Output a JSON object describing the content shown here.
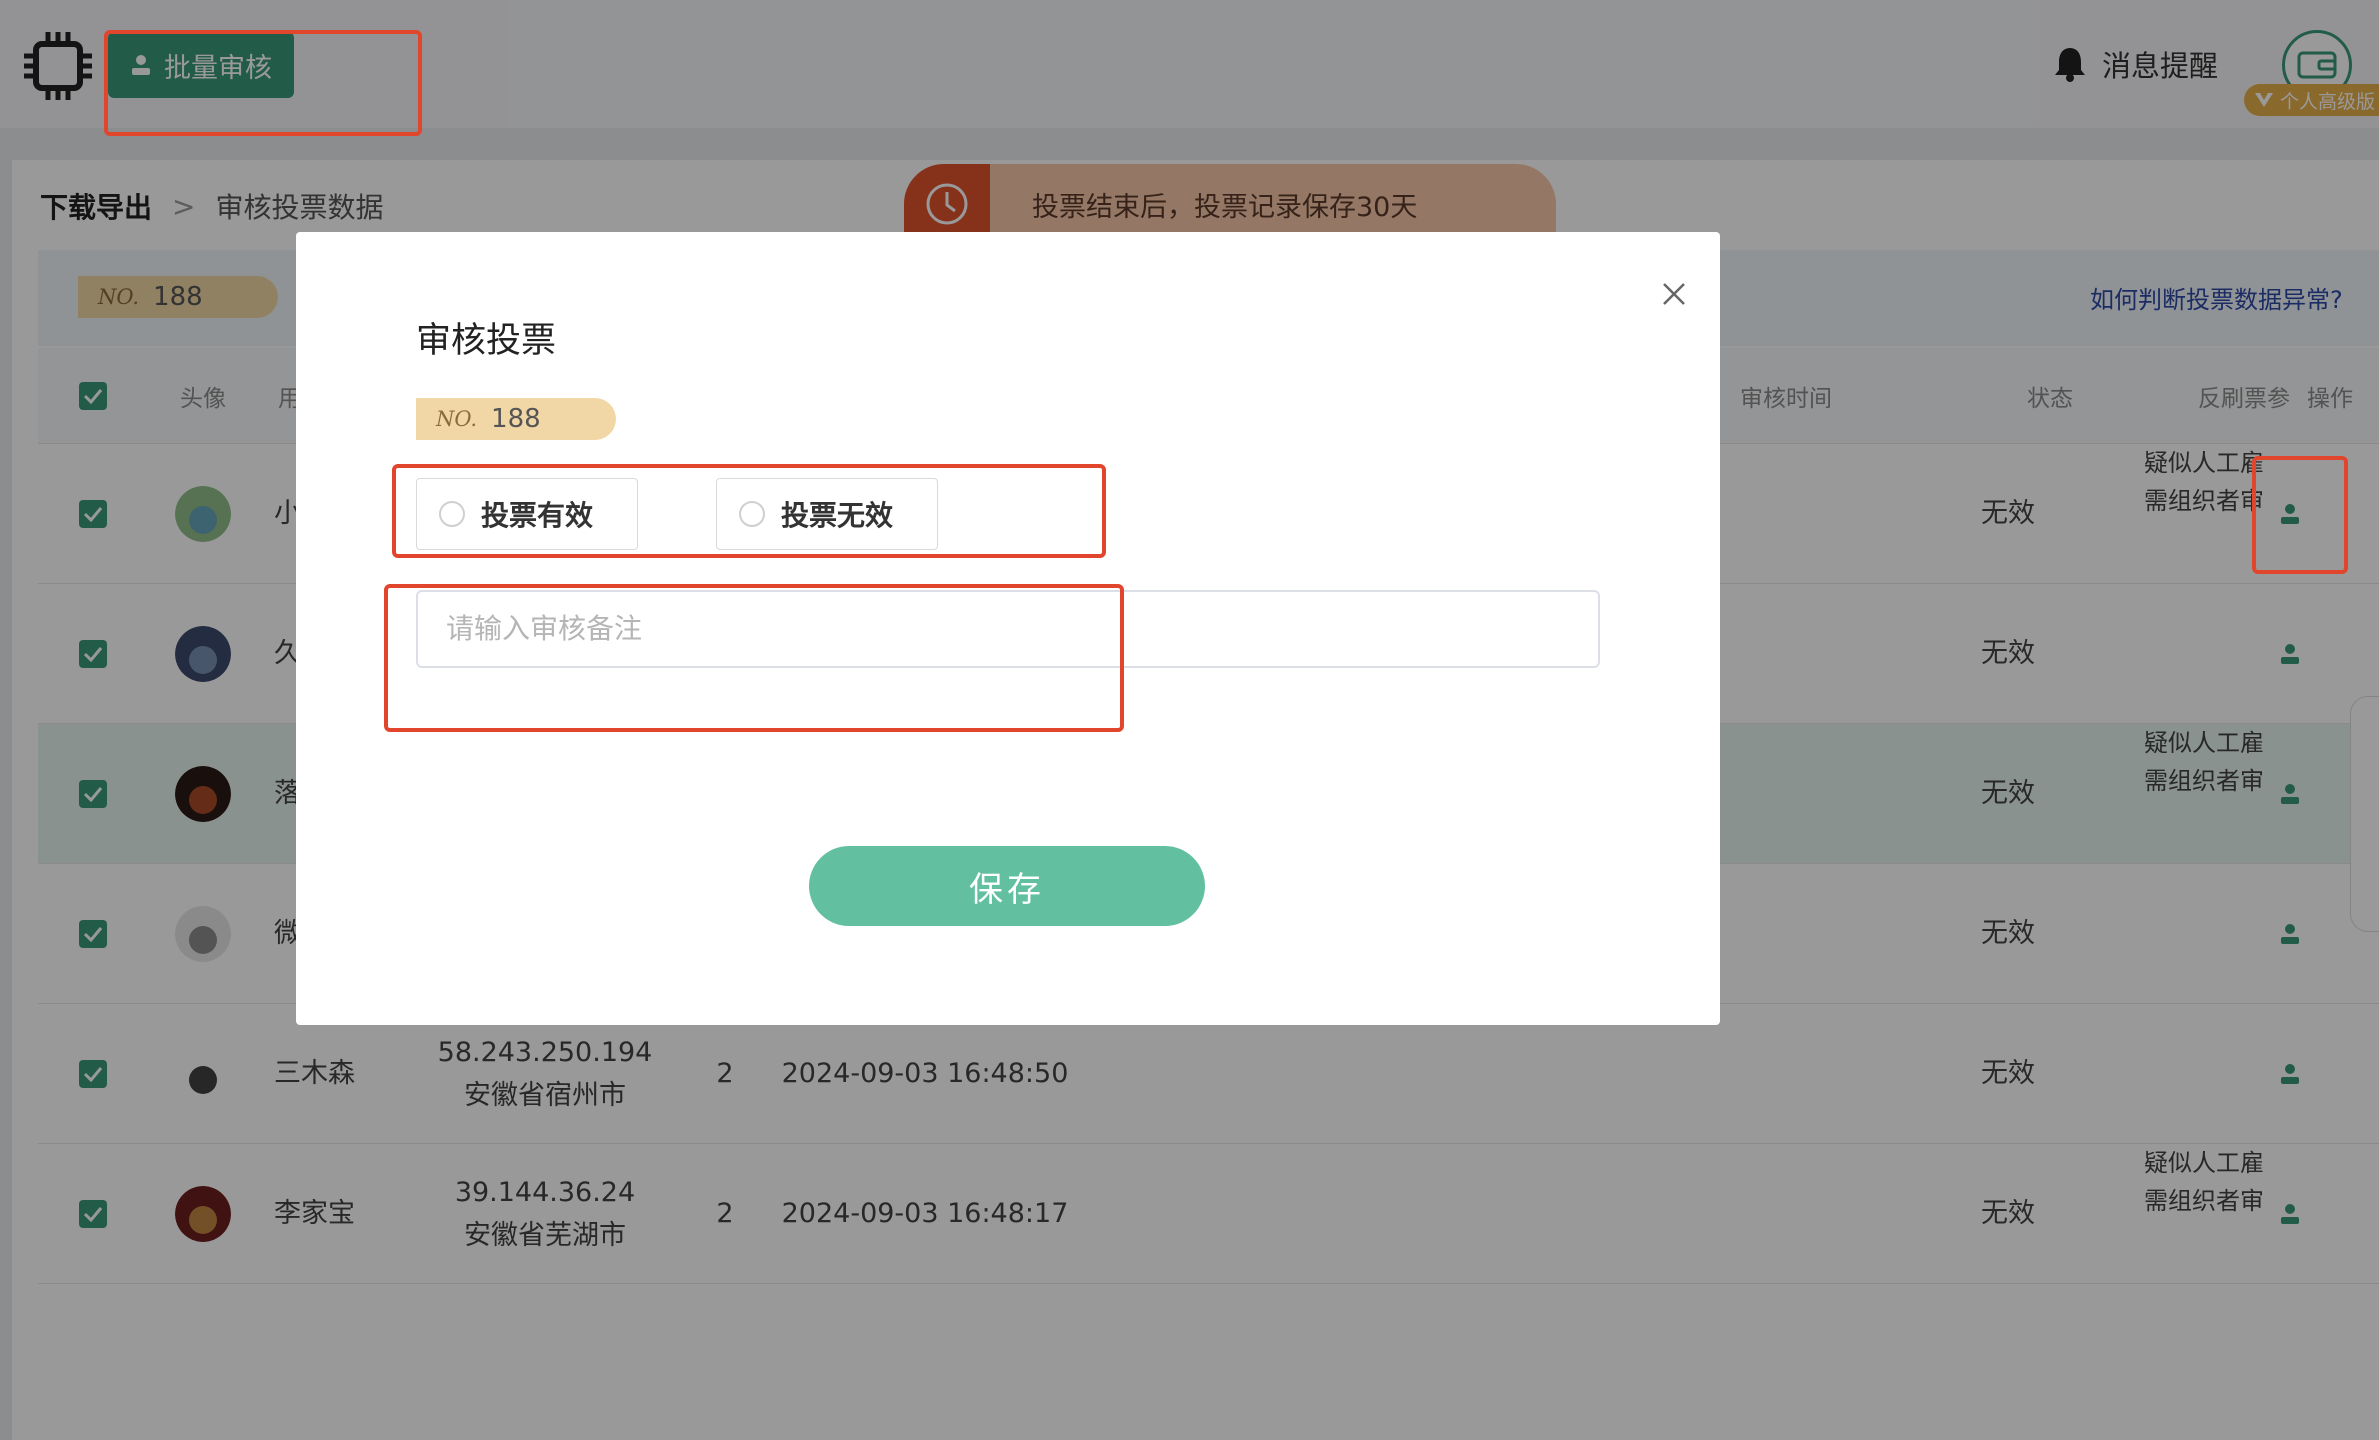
{
  "topbar": {
    "batch_label": "批量审核",
    "notice_label": "消息提醒",
    "vip_label": "个人高级版"
  },
  "breadcrumb": {
    "home": "下载导出",
    "sep": ">",
    "current": "审核投票数据"
  },
  "banner": {
    "text": "投票结束后，投票记录保存30天"
  },
  "badge": {
    "prefix": "NO.",
    "number": "188"
  },
  "help_link": "如何判断投票数据异常?",
  "table": {
    "headers": {
      "avatar": "头像",
      "user": "用",
      "audit_time": "审核时间",
      "status": "状态",
      "params": "反刷票参",
      "op": "操作"
    },
    "rows": [
      {
        "name": "小",
        "ip": "",
        "region": "",
        "count": "",
        "time": "",
        "status": "无效",
        "param1": "疑似人工雇",
        "param2": "需组织者审"
      },
      {
        "name": "久",
        "ip": "",
        "region": "",
        "count": "",
        "time": "",
        "status": "无效",
        "param1": "",
        "param2": ""
      },
      {
        "name": "落",
        "ip": "",
        "region": "",
        "count": "",
        "time": "",
        "status": "无效",
        "param1": "疑似人工雇",
        "param2": "需组织者审"
      },
      {
        "name": "微",
        "ip": "",
        "region": "",
        "count": "",
        "time": "",
        "status": "无效",
        "param1": "",
        "param2": ""
      },
      {
        "name": "三木森",
        "ip": "58.243.250.194",
        "region": "安徽省宿州市",
        "count": "2",
        "time": "2024-09-03 16:48:50",
        "status": "无效",
        "param1": "",
        "param2": ""
      },
      {
        "name": "李家宝",
        "ip": "39.144.36.24",
        "region": "安徽省芜湖市",
        "count": "2",
        "time": "2024-09-03 16:48:17",
        "status": "无效",
        "param1": "疑似人工雇",
        "param2": "需组织者审"
      }
    ]
  },
  "modal": {
    "title": "审核投票",
    "option_valid": "投票有效",
    "option_invalid": "投票无效",
    "remark_placeholder": "请输入审核备注",
    "save_label": "保存",
    "close_symbol": "×"
  },
  "colors": {
    "primary": "#3a9a78",
    "save": "#62c0a1",
    "annotation": "#e1452b",
    "link": "#2e4aa8"
  }
}
